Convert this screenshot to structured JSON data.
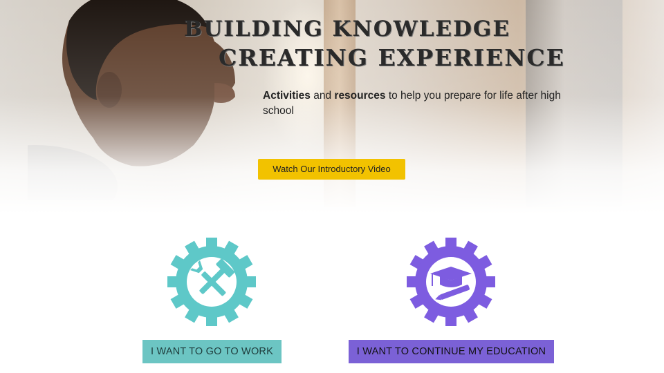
{
  "hero": {
    "title_line1": "BUILDING KNOWLEDGE",
    "title_line2": "CREATING EXPERIENCE",
    "subtitle": {
      "word1": "Activities",
      "mid": " and ",
      "word2": "resources",
      "rest": " to help you prepare for life after high school"
    },
    "video_button": "Watch Our Introductory Video"
  },
  "paths": {
    "work": {
      "label": "I WANT TO GO TO WORK",
      "icon": "hammer-wrench-gear-icon",
      "color": "#5ec8c8"
    },
    "education": {
      "label": "I WANT TO CONTINUE MY EDUCATION",
      "icon": "graduation-cap-pen-gear-icon",
      "color": "#7d5ce0"
    }
  },
  "colors": {
    "accent_yellow": "#f2c200",
    "teal": "#6cc5c3",
    "purple": "#7b61d6"
  }
}
